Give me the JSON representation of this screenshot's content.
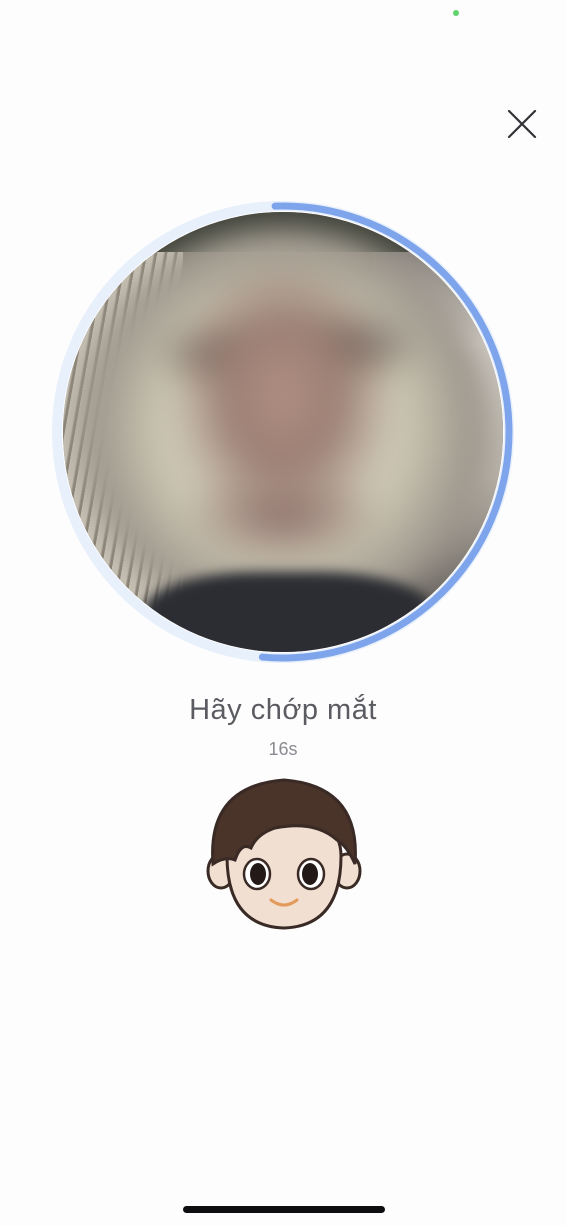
{
  "instruction": {
    "text": "Hãy chớp mắt"
  },
  "countdown": {
    "text": "16s"
  },
  "progress": {
    "value": 0.52,
    "color": "#7ea4ec",
    "track_color": "#e8f0fc"
  },
  "icons": {
    "close": "close-icon",
    "avatar": "face-avatar-icon"
  },
  "colors": {
    "status_dot": "#5ed36a",
    "text_primary": "#5b5c61",
    "text_secondary": "#8a8b90"
  }
}
